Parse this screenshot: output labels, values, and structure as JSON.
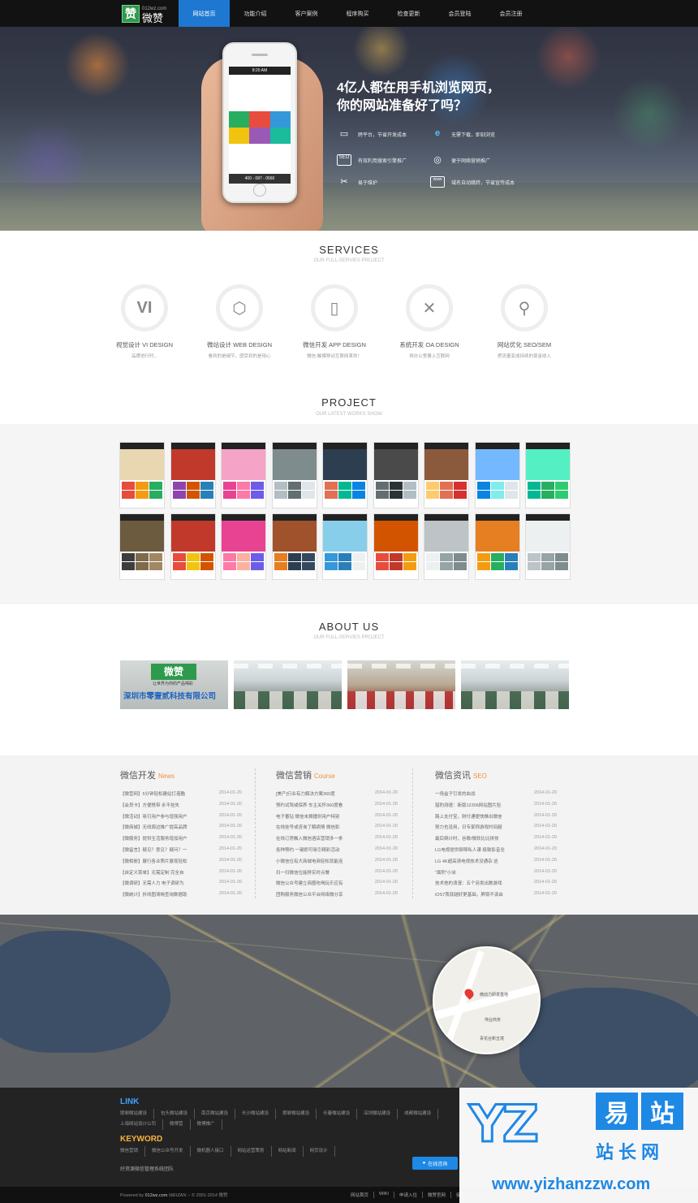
{
  "header": {
    "logo_mark": "赞",
    "logo_text": "微赞",
    "logo_small": "012wz.com",
    "nav": [
      "网站首页",
      "功能介绍",
      "客户案例",
      "程序购买",
      "检查更新",
      "会员登陆",
      "会员注册"
    ]
  },
  "hero": {
    "title_line1": "4亿人都在用手机浏览网页，",
    "title_line2": "你的网站准备好了吗？",
    "features": [
      {
        "icon": "monitor-icon",
        "glyph": "▭",
        "text": "跨平台，节省开发成本"
      },
      {
        "icon": "ie-icon",
        "glyph": "e",
        "text": "无需下载，即刻浏览"
      },
      {
        "icon": "seo-icon",
        "glyph": "SEO",
        "text": "有效利用搜索引擎推广"
      },
      {
        "icon": "target-icon",
        "glyph": "◎",
        "text": "便于网络营销推广"
      },
      {
        "icon": "tools-icon",
        "glyph": "✂",
        "text": "易于维护"
      },
      {
        "icon": "www-icon",
        "glyph": "www",
        "text": "域名自动跳转，节省宣传成本"
      }
    ],
    "phone_time": "8:20 AM",
    "phone_phone": "400 - 087 - 0560"
  },
  "services": {
    "title": "SERVICES",
    "subtitle": "OUR FULL-SERVIES PROJECT",
    "items": [
      {
        "glyph": "VI",
        "icon": "vi-icon",
        "name": "视觉设计 VI DESIGN",
        "desc": "品牌进行时..."
      },
      {
        "glyph": "⬡",
        "icon": "html5-icon",
        "name": "微站设计 WEB DESIGN",
        "desc": "看到的是细节，感受到的是用心"
      },
      {
        "glyph": "▯",
        "icon": "phone-icon",
        "name": "微信开发 APP DESIGN",
        "desc": "微信-触摸移动互联网革命！"
      },
      {
        "glyph": "✕",
        "icon": "tools-icon",
        "name": "系统开发 OA DESIGN",
        "desc": "将办公室搬上互联网"
      },
      {
        "glyph": "⚲",
        "icon": "search-icon",
        "name": "网站优化 SEO/SEM",
        "desc": "把流量变成持续的现金收入"
      }
    ]
  },
  "project": {
    "title": "PROJECT",
    "subtitle": "OUR LATEST WORKS SHOW",
    "items": [
      {
        "img": "#e8d7b0",
        "c": [
          "#e74c3c",
          "#f39c12",
          "#27ae60"
        ]
      },
      {
        "img": "#c0392b",
        "c": [
          "#8e44ad",
          "#d35400",
          "#2980b9"
        ]
      },
      {
        "img": "#f5a3c7",
        "c": [
          "#e84393",
          "#fd79a8",
          "#6c5ce7"
        ]
      },
      {
        "img": "#7f8c8d",
        "c": [
          "#b2bec3",
          "#636e72",
          "#dfe6e9"
        ]
      },
      {
        "img": "#2c3e50",
        "c": [
          "#e17055",
          "#00b894",
          "#0984e3"
        ]
      },
      {
        "img": "#4a4a4a",
        "c": [
          "#636e72",
          "#2d3436",
          "#b2bec3"
        ]
      },
      {
        "img": "#8b5a3c",
        "c": [
          "#fdcb6e",
          "#e17055",
          "#d63031"
        ]
      },
      {
        "img": "#74b9ff",
        "c": [
          "#0984e3",
          "#81ecec",
          "#dfe6e9"
        ]
      },
      {
        "img": "#55efc4",
        "c": [
          "#00b894",
          "#27ae60",
          "#2ecc71"
        ]
      },
      {
        "img": "#6d5b3f",
        "c": [
          "#3d3d3d",
          "#7f6a4a",
          "#a18762"
        ]
      },
      {
        "img": "#c0392b",
        "c": [
          "#e74c3c",
          "#f1c40f",
          "#d35400"
        ]
      },
      {
        "img": "#e84393",
        "c": [
          "#fd79a8",
          "#fab1a0",
          "#6c5ce7"
        ]
      },
      {
        "img": "#a0522d",
        "c": [
          "#e67e22",
          "#2c3e50",
          "#34495e"
        ]
      },
      {
        "img": "#87ceeb",
        "c": [
          "#3498db",
          "#2980b9",
          "#ecf0f1"
        ]
      },
      {
        "img": "#d35400",
        "c": [
          "#e74c3c",
          "#c0392b",
          "#f39c12"
        ]
      },
      {
        "img": "#bdc3c7",
        "c": [
          "#ecf0f1",
          "#95a5a6",
          "#7f8c8d"
        ]
      },
      {
        "img": "#e67e22",
        "c": [
          "#f39c12",
          "#27ae60",
          "#2980b9"
        ]
      },
      {
        "img": "#ecf0f1",
        "c": [
          "#bdc3c7",
          "#95a5a6",
          "#7f8c8d"
        ]
      }
    ]
  },
  "about": {
    "title": "ABOUT US",
    "subtitle": "OUR FULL-SERVIES PROJECT",
    "company_logo": "微赞",
    "company_sub": "让世界为你的产品喝彩",
    "company_name": "深圳市零壹贰科技有限公司"
  },
  "news": {
    "columns": [
      {
        "title": "微信开发",
        "en": "News",
        "rows": [
          [
            "【微营网】5分钟轻松建站打造酷",
            "2014-01-20"
          ],
          [
            "【会员卡】方便携带 永不挂失",
            "2014-01-20"
          ],
          [
            "【微活动】吸引用户参与增强用户",
            "2014-01-20"
          ],
          [
            "【微商城】无线周边推广提高品牌",
            "2014-01-20"
          ],
          [
            "【微服务】提供生活服务增加用户",
            "2014-01-20"
          ],
          [
            "【微留言】疑见？意见？疑问？一",
            "2014-01-20"
          ],
          [
            "【微相册】展行各业照片展现轻松",
            "2014-01-20"
          ],
          [
            "【自定义菜单】无需定制 完全自",
            "2014-01-20"
          ],
          [
            "【微调研】无需人力 电子调研为",
            "2014-01-20"
          ],
          [
            "【微统计】折线图清晰查询数据助",
            "2014-01-20"
          ]
        ]
      },
      {
        "title": "微信营销",
        "en": "Course",
        "rows": [
          [
            "[美产]行业有力解决方案360度",
            "2014-01-20"
          ],
          [
            "预约试驾或保养 车主关怀360度看",
            "2014-01-20"
          ],
          [
            "电子番钻 微信未拥播供用户特别",
            "2014-01-20"
          ],
          [
            "在线挂号或咨询了解病情 微信影",
            "2014-01-20"
          ],
          [
            "在线订房触入微信酒店营销多一条",
            "2014-01-20"
          ],
          [
            "各种预约 一键即可吸引精彩活动",
            "2014-01-20"
          ],
          [
            "小微信位有大商城电商轻松就能连",
            "2014-01-20"
          ],
          [
            "扫一扫微信位能移实时点餐",
            "2014-01-20"
          ],
          [
            "微信公众号建立商圈吃喝玩乐应有",
            "2014-01-20"
          ],
          [
            "团购服务微信公众平台网络微分享",
            "2014-01-20"
          ]
        ]
      },
      {
        "title": "微信资讯",
        "en": "SEO",
        "rows": [
          [
            "一场盒子引发的血战",
            "2014-01-20"
          ],
          [
            "猎豹测速：新版12306网站图片验",
            "2014-01-20"
          ],
          [
            "路上支付宝，财付通便快推出微信",
            "2014-01-20"
          ],
          [
            "努力也没用，日专家称游戏时间越",
            "2014-01-20"
          ],
          [
            "最后倒计时，谷歌/微软比比拼技",
            "2014-01-20"
          ],
          [
            "LG电视提供钢琴私人课 极致影音全",
            "2014-01-20"
          ],
          [
            "LG 4K超高清电视技术没通杂 这",
            "2014-01-20"
          ],
          [
            "\"面积\"小米",
            "2014-01-20"
          ],
          [
            "技术他的浪漫：五个另类出数游戏",
            "2014-01-20"
          ],
          [
            "iOS7我就越好更基础，屏锁不该由",
            "2014-01-20"
          ]
        ]
      }
    ]
  },
  "map": {
    "label_main": "微动力研发基地",
    "label_2": "伟业商务",
    "label_3": "青花台新五境"
  },
  "footer": {
    "link_title": "LINK",
    "links": [
      "邯郸微站建设",
      "包头微站建设",
      "南京微站建设",
      "长沙微站建设",
      "邯郸微站建设",
      "长春微站建设",
      "深圳微站建设",
      "成都微站建设",
      "上海网站设计公司",
      "微博营",
      "微博推广"
    ],
    "keyword_title": "KEYWORD",
    "keywords": [
      "微信营销",
      "微信公众号开发",
      "微机器人接口",
      "网站运营策划",
      "网站新闻",
      "网页设计"
    ],
    "team": "好资源微信管理系统团队",
    "copy_prefix": "Powered by",
    "copy_site": "012wz.com",
    "copy_brand": "WEIZAN",
    "copy_rest": "-- © 2001-2014 微赞",
    "bottom_links": [
      "网站首页",
      "WIKI",
      "申请入住",
      "微赞官网",
      "接口"
    ],
    "qq_label": "在线咨询",
    "link_color": "#3ea3ff",
    "keyword_color": "#f7b43c"
  },
  "watermark": {
    "yz": "YZ",
    "cn1": [
      "易",
      "站"
    ],
    "cn2": "站长网",
    "url": "www.yizhanzzw.com"
  }
}
